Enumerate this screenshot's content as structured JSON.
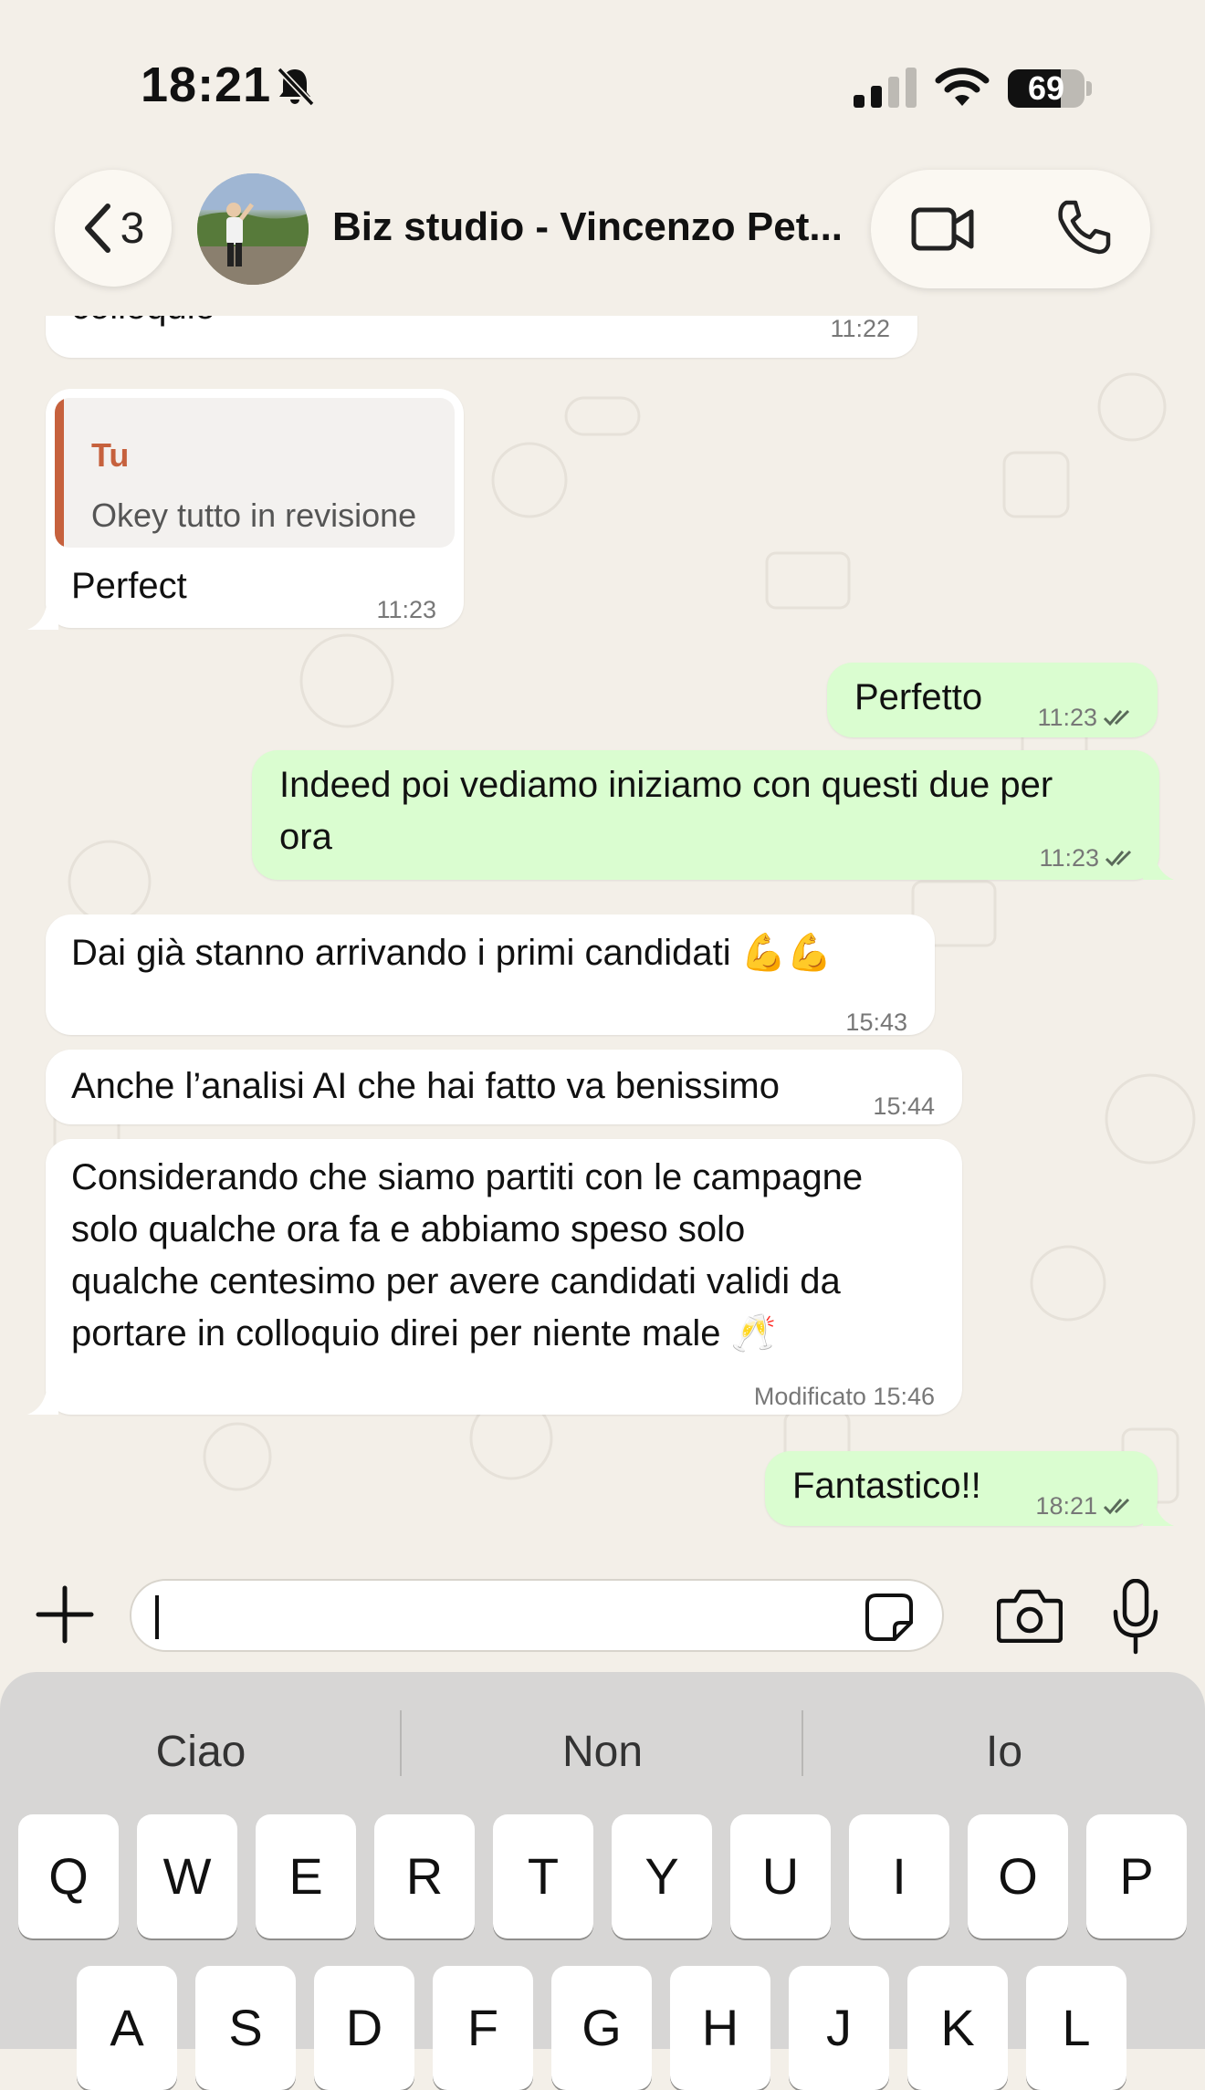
{
  "status_bar": {
    "time": "18:21",
    "battery_level": "69",
    "battery_fraction": 0.69,
    "icons": [
      "bell-muted-icon",
      "signal-icon",
      "wifi-icon",
      "battery-icon"
    ]
  },
  "header": {
    "back_count": "3",
    "title": "Biz studio - Vincenzo Pet...",
    "icons": [
      "back-chevron-icon",
      "video-call-icon",
      "phone-call-icon"
    ]
  },
  "messages": [
    {
      "direction": "in",
      "text": "colloquio",
      "time": "11:22"
    },
    {
      "direction": "in",
      "quote_author": "Tu",
      "quote_text": "Okey tutto in revisione",
      "text": "Perfect",
      "time": "11:23"
    },
    {
      "direction": "out",
      "text": "Perfetto",
      "time": "11:23",
      "read": true
    },
    {
      "direction": "out",
      "text": "Indeed poi vediamo iniziamo con questi due per\nora",
      "time": "11:23",
      "read": true
    },
    {
      "direction": "in",
      "text": "Dai già stanno arrivando i primi candidati 💪💪",
      "time": "15:43"
    },
    {
      "direction": "in",
      "text": "Anche l’analisi AI che hai fatto va benissimo",
      "time": "15:44"
    },
    {
      "direction": "in",
      "text": "Considerando che siamo partiti con le campagne\nsolo qualche ora fa e abbiamo speso solo\nqualche centesimo per avere candidati validi da\nportare in colloquio direi per niente male 🥂",
      "time": "Modificato 15:46"
    },
    {
      "direction": "out",
      "text": "Fantastico!!",
      "time": "18:21",
      "read": true
    }
  ],
  "input": {
    "value": "",
    "icons": [
      "plus-icon",
      "sticker-icon",
      "camera-icon",
      "microphone-icon"
    ]
  },
  "keyboard": {
    "suggestions": [
      "Ciao",
      "Non",
      "Io"
    ],
    "row1": [
      "Q",
      "W",
      "E",
      "R",
      "T",
      "Y",
      "U",
      "I",
      "O",
      "P"
    ],
    "row2": [
      "A",
      "S",
      "D",
      "F",
      "G",
      "H",
      "J",
      "K",
      "L"
    ]
  },
  "colors": {
    "background": "#f3efe8",
    "incoming_bubble": "#ffffff",
    "outgoing_bubble": "#dafdd0",
    "quote_accent": "#c6613d",
    "read_ticks": "#5a6a5a"
  }
}
